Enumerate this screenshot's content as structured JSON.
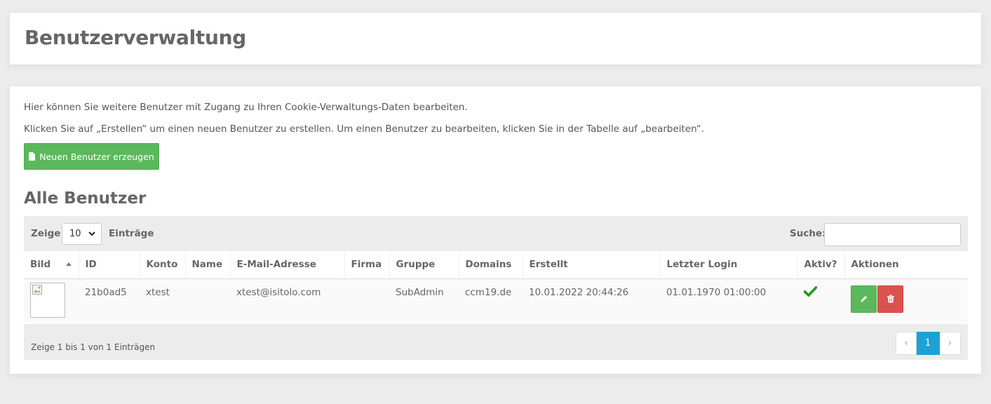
{
  "header": {
    "title": "Benutzerverwaltung"
  },
  "intro": {
    "line1": "Hier können Sie weitere Benutzer mit Zugang zu Ihren Cookie-Verwaltungs-Daten bearbeiten.",
    "line2": "Klicken Sie auf „Erstellen“ um einen neuen Benutzer zu erstellen. Um einen Benutzer zu bearbeiten, klicken Sie in der Tabelle auf „bearbeiten“."
  },
  "create_button": {
    "label": "Neuen Benutzer erzeugen",
    "icon": "file-icon",
    "color": "#5cb85c"
  },
  "section_title": "Alle Benutzer",
  "length_control": {
    "prefix": "Zeige",
    "value": "10",
    "suffix": "Einträge"
  },
  "search": {
    "label": "Suche:",
    "value": ""
  },
  "table": {
    "columns": [
      "Bild",
      "ID",
      "Konto",
      "Name",
      "E-Mail-Adresse",
      "Firma",
      "Gruppe",
      "Domains",
      "Erstellt",
      "Letzter Login",
      "Aktiv?",
      "Aktionen"
    ],
    "sorted_column": "Bild",
    "rows": [
      {
        "id": "21b0ad5",
        "konto": "xtest",
        "name": "",
        "email": "xtest@isitolo.com",
        "firma": "",
        "gruppe": "SubAdmin",
        "domains": "ccm19.de",
        "erstellt": "10.01.2022 20:44:26",
        "letzter_login": "01.01.1970 01:00:00",
        "aktiv": true
      }
    ]
  },
  "footer": {
    "info": "Zeige 1 bis 1 von 1 Einträgen",
    "pagination": {
      "prev": "‹",
      "current": "1",
      "next": "›"
    }
  },
  "colors": {
    "accent": "#1ba1d6",
    "success": "#5cb85c",
    "danger": "#d9534f",
    "check": "#1a9b1a"
  }
}
